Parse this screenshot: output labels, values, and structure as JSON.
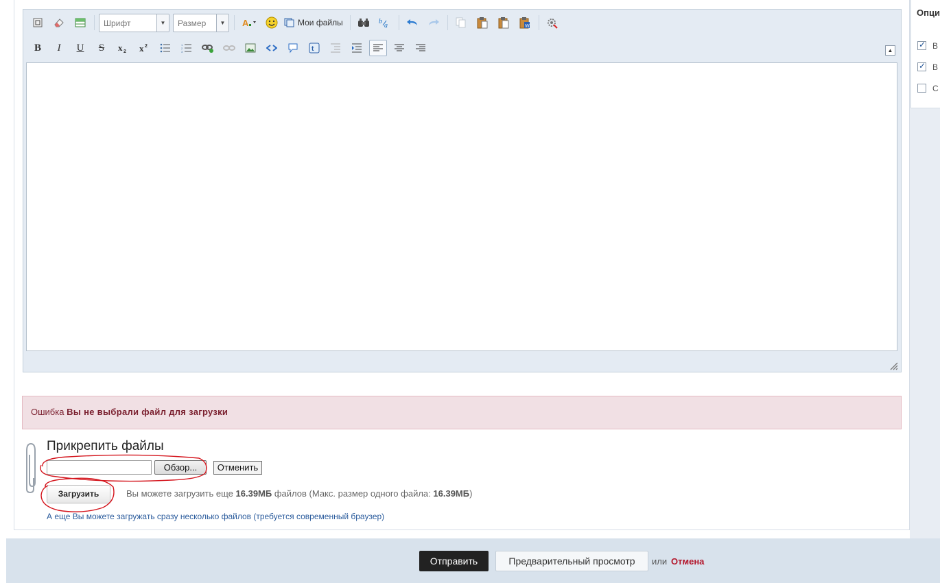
{
  "options": {
    "title": "Опции",
    "items": [
      {
        "label": "В",
        "checked": true
      },
      {
        "label": "В",
        "checked": true
      },
      {
        "label": "С",
        "checked": false
      }
    ]
  },
  "toolbar": {
    "font_combo": "Шрифт",
    "size_combo": "Размер",
    "my_files": "Мои файлы",
    "bold": "B",
    "italic": "I",
    "underline": "U",
    "strike": "S",
    "subscript": "x",
    "superscript": "x"
  },
  "error": {
    "prefix": "Ошибка",
    "message": "Вы не выбрали файл для загрузки"
  },
  "attach": {
    "title": "Прикрепить файлы",
    "browse": "Обзор...",
    "cancel": "Отменить",
    "upload": "Загрузить",
    "info_part1": "Вы можете загрузить еще",
    "info_size": "16.39МБ",
    "info_part2": "файлов (Макс. размер одного файла:",
    "info_max": "16.39МБ",
    "info_part3": ")",
    "multi_link": "А еще Вы можете загружать сразу несколько файлов (требуется современный браузер)"
  },
  "footer": {
    "send": "Отправить",
    "preview": "Предварительный просмотр",
    "or": "или",
    "cancel": "Отмена"
  },
  "colors": {
    "error_bg": "#f1e0e4",
    "error_text": "#7a1f2e",
    "link": "#2a5b9c",
    "cancel_link": "#b3162b",
    "annotation": "#d4141c"
  }
}
